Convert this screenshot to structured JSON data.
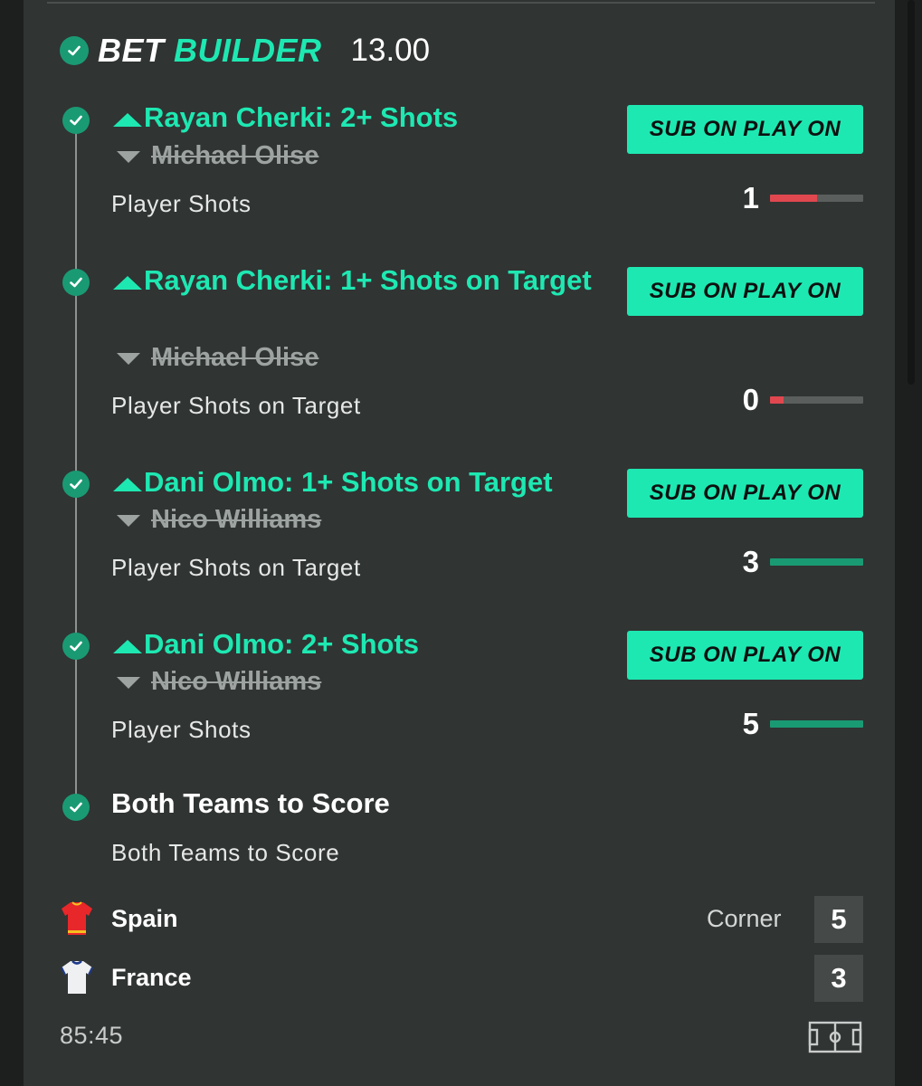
{
  "header": {
    "title_part1": "BET",
    "title_part2": "BUILDER",
    "odds": "13.00"
  },
  "selections": [
    {
      "title": "Rayan Cherki: 2+ Shots",
      "substitute": "Michael Olise",
      "market": "Player Shots",
      "button": "SUB ON PLAY ON",
      "count": "1",
      "progress": 0.5,
      "progress_color": "#e0474f"
    },
    {
      "title": "Rayan Cherki: 1+ Shots on Target",
      "substitute": "Michael Olise",
      "market": "Player Shots on Target",
      "button": "SUB ON PLAY ON",
      "count": "0",
      "progress": 0.15,
      "progress_color": "#e0474f"
    },
    {
      "title": "Dani Olmo: 1+ Shots on Target",
      "substitute": "Nico Williams",
      "market": "Player Shots on Target",
      "button": "SUB ON PLAY ON",
      "count": "3",
      "progress": 1.0,
      "progress_color": "#1a9a73"
    },
    {
      "title": "Dani Olmo: 2+ Shots",
      "substitute": "Nico Williams",
      "market": "Player Shots",
      "button": "SUB ON PLAY ON",
      "count": "5",
      "progress": 1.0,
      "progress_color": "#1a9a73"
    }
  ],
  "btts": {
    "title": "Both Teams to Score",
    "market": "Both Teams to Score"
  },
  "match": {
    "home_team": "Spain",
    "away_team": "France",
    "stat_label": "Corner",
    "home_corners": "5",
    "away_corners": "3",
    "clock": "85:45"
  },
  "icons": {
    "check": "check-circle-icon",
    "up": "chevron-up-icon",
    "down": "chevron-down-icon",
    "home_shirt": "spain-shirt-icon",
    "away_shirt": "france-shirt-icon",
    "pitch": "pitch-icon"
  },
  "colors": {
    "accent": "#1ee8b2",
    "check_green": "#1a9a73",
    "card_bg": "#303433",
    "red": "#e0474f"
  }
}
